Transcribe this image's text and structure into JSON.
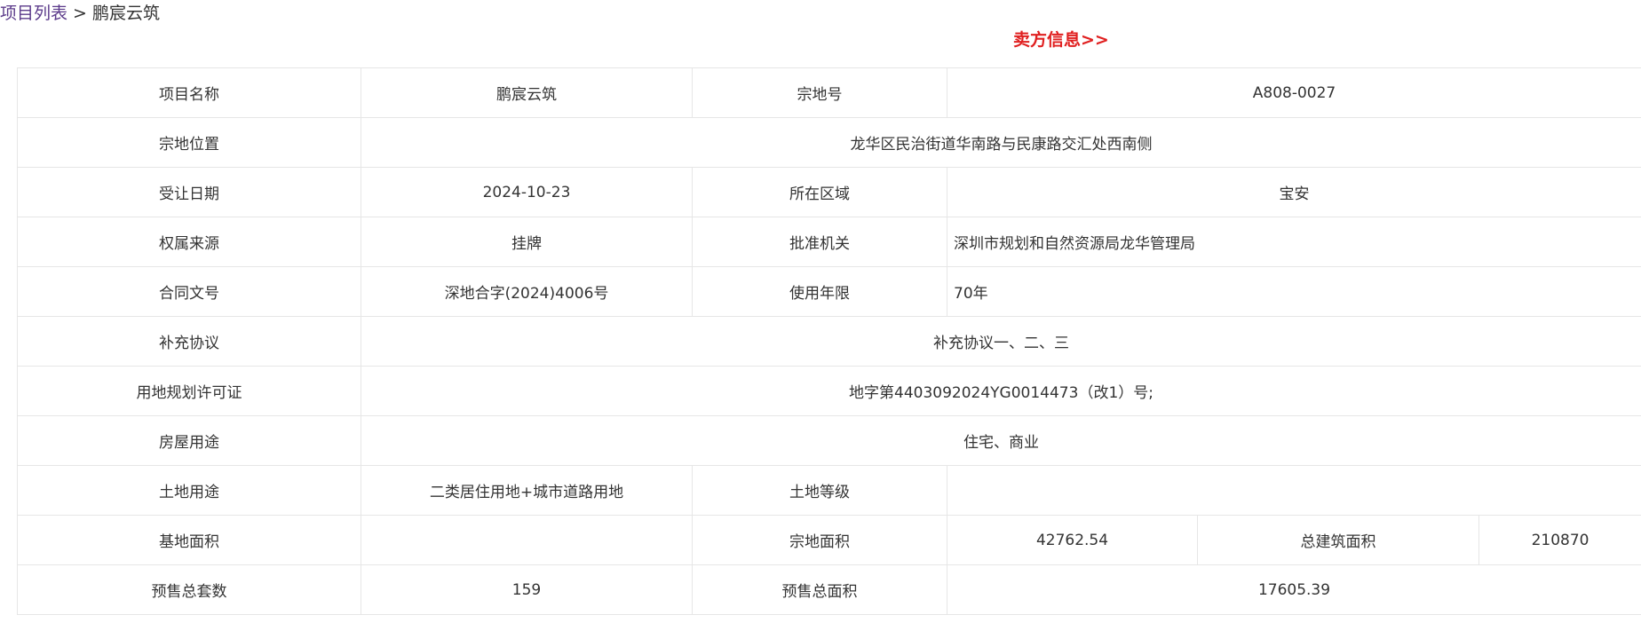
{
  "breadcrumb": {
    "root": "项目列表",
    "separator": ">",
    "current": "鹏宸云筑"
  },
  "seller_link": "卖方信息>>",
  "colors": {
    "link": "#5b3a8a",
    "seller_link": "#e02020",
    "border": "#e6e6e6",
    "text": "#333333"
  },
  "rows": {
    "project_name": {
      "label": "项目名称",
      "value": "鹏宸云筑",
      "label2": "宗地号",
      "value2": "A808-0027"
    },
    "parcel_location": {
      "label": "宗地位置",
      "value": "龙华区民治街道华南路与民康路交汇处西南侧"
    },
    "transfer_date": {
      "label": "受让日期",
      "value": "2024-10-23",
      "label2": "所在区域",
      "value2": "宝安"
    },
    "ownership_source": {
      "label": "权属来源",
      "value": "挂牌",
      "label2": "批准机关",
      "value2": "深圳市规划和自然资源局龙华管理局"
    },
    "contract_no": {
      "label": "合同文号",
      "value": "深地合字(2024)4006号",
      "label2": "使用年限",
      "value2": "70年"
    },
    "supplement": {
      "label": "补充协议",
      "value": "补充协议一、二、三"
    },
    "land_permit": {
      "label": "用地规划许可证",
      "value": "地字第4403092024YG0014473（改1）号;"
    },
    "house_use": {
      "label": "房屋用途",
      "value": "住宅、商业"
    },
    "land_use": {
      "label": "土地用途",
      "value": "二类居住用地+城市道路用地",
      "label2": "土地等级",
      "value2": ""
    },
    "area": {
      "label": "基地面积",
      "value": "",
      "label2": "宗地面积",
      "value2": "42762.54",
      "label3": "总建筑面积",
      "value3": "210870"
    },
    "presale": {
      "label": "预售总套数",
      "value": "159",
      "label2": "预售总面积",
      "value2": "17605.39"
    }
  }
}
